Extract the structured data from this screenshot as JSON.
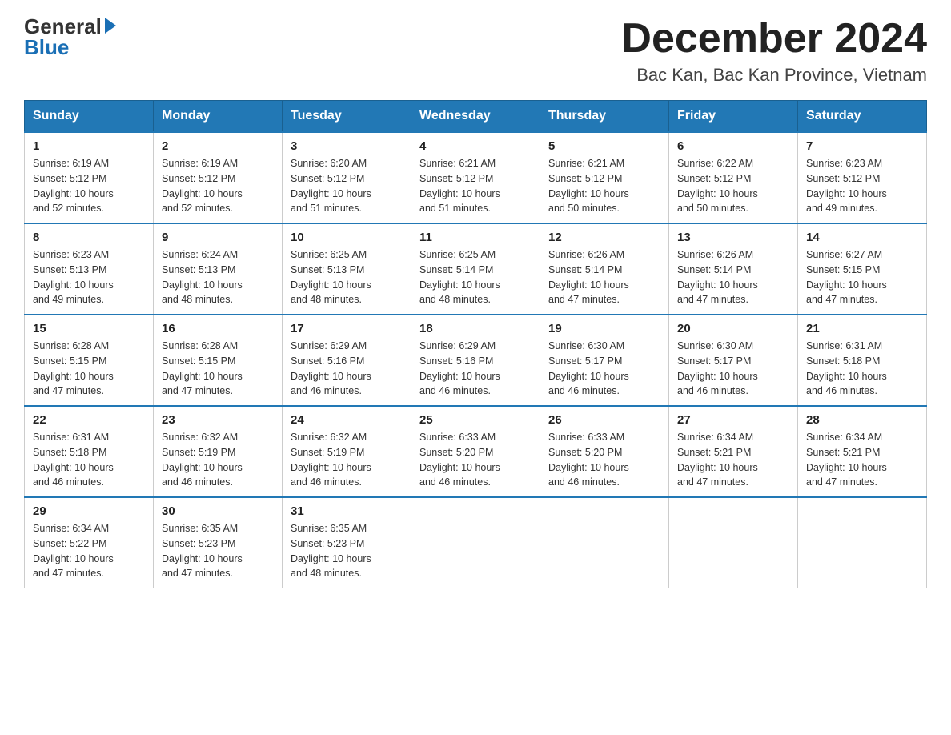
{
  "header": {
    "logo_general": "General",
    "logo_blue": "Blue",
    "title": "December 2024",
    "subtitle": "Bac Kan, Bac Kan Province, Vietnam"
  },
  "days_of_week": [
    "Sunday",
    "Monday",
    "Tuesday",
    "Wednesday",
    "Thursday",
    "Friday",
    "Saturday"
  ],
  "weeks": [
    [
      {
        "day": "1",
        "sunrise": "6:19 AM",
        "sunset": "5:12 PM",
        "daylight": "10 hours and 52 minutes."
      },
      {
        "day": "2",
        "sunrise": "6:19 AM",
        "sunset": "5:12 PM",
        "daylight": "10 hours and 52 minutes."
      },
      {
        "day": "3",
        "sunrise": "6:20 AM",
        "sunset": "5:12 PM",
        "daylight": "10 hours and 51 minutes."
      },
      {
        "day": "4",
        "sunrise": "6:21 AM",
        "sunset": "5:12 PM",
        "daylight": "10 hours and 51 minutes."
      },
      {
        "day": "5",
        "sunrise": "6:21 AM",
        "sunset": "5:12 PM",
        "daylight": "10 hours and 50 minutes."
      },
      {
        "day": "6",
        "sunrise": "6:22 AM",
        "sunset": "5:12 PM",
        "daylight": "10 hours and 50 minutes."
      },
      {
        "day": "7",
        "sunrise": "6:23 AM",
        "sunset": "5:12 PM",
        "daylight": "10 hours and 49 minutes."
      }
    ],
    [
      {
        "day": "8",
        "sunrise": "6:23 AM",
        "sunset": "5:13 PM",
        "daylight": "10 hours and 49 minutes."
      },
      {
        "day": "9",
        "sunrise": "6:24 AM",
        "sunset": "5:13 PM",
        "daylight": "10 hours and 48 minutes."
      },
      {
        "day": "10",
        "sunrise": "6:25 AM",
        "sunset": "5:13 PM",
        "daylight": "10 hours and 48 minutes."
      },
      {
        "day": "11",
        "sunrise": "6:25 AM",
        "sunset": "5:14 PM",
        "daylight": "10 hours and 48 minutes."
      },
      {
        "day": "12",
        "sunrise": "6:26 AM",
        "sunset": "5:14 PM",
        "daylight": "10 hours and 47 minutes."
      },
      {
        "day": "13",
        "sunrise": "6:26 AM",
        "sunset": "5:14 PM",
        "daylight": "10 hours and 47 minutes."
      },
      {
        "day": "14",
        "sunrise": "6:27 AM",
        "sunset": "5:15 PM",
        "daylight": "10 hours and 47 minutes."
      }
    ],
    [
      {
        "day": "15",
        "sunrise": "6:28 AM",
        "sunset": "5:15 PM",
        "daylight": "10 hours and 47 minutes."
      },
      {
        "day": "16",
        "sunrise": "6:28 AM",
        "sunset": "5:15 PM",
        "daylight": "10 hours and 47 minutes."
      },
      {
        "day": "17",
        "sunrise": "6:29 AM",
        "sunset": "5:16 PM",
        "daylight": "10 hours and 46 minutes."
      },
      {
        "day": "18",
        "sunrise": "6:29 AM",
        "sunset": "5:16 PM",
        "daylight": "10 hours and 46 minutes."
      },
      {
        "day": "19",
        "sunrise": "6:30 AM",
        "sunset": "5:17 PM",
        "daylight": "10 hours and 46 minutes."
      },
      {
        "day": "20",
        "sunrise": "6:30 AM",
        "sunset": "5:17 PM",
        "daylight": "10 hours and 46 minutes."
      },
      {
        "day": "21",
        "sunrise": "6:31 AM",
        "sunset": "5:18 PM",
        "daylight": "10 hours and 46 minutes."
      }
    ],
    [
      {
        "day": "22",
        "sunrise": "6:31 AM",
        "sunset": "5:18 PM",
        "daylight": "10 hours and 46 minutes."
      },
      {
        "day": "23",
        "sunrise": "6:32 AM",
        "sunset": "5:19 PM",
        "daylight": "10 hours and 46 minutes."
      },
      {
        "day": "24",
        "sunrise": "6:32 AM",
        "sunset": "5:19 PM",
        "daylight": "10 hours and 46 minutes."
      },
      {
        "day": "25",
        "sunrise": "6:33 AM",
        "sunset": "5:20 PM",
        "daylight": "10 hours and 46 minutes."
      },
      {
        "day": "26",
        "sunrise": "6:33 AM",
        "sunset": "5:20 PM",
        "daylight": "10 hours and 46 minutes."
      },
      {
        "day": "27",
        "sunrise": "6:34 AM",
        "sunset": "5:21 PM",
        "daylight": "10 hours and 47 minutes."
      },
      {
        "day": "28",
        "sunrise": "6:34 AM",
        "sunset": "5:21 PM",
        "daylight": "10 hours and 47 minutes."
      }
    ],
    [
      {
        "day": "29",
        "sunrise": "6:34 AM",
        "sunset": "5:22 PM",
        "daylight": "10 hours and 47 minutes."
      },
      {
        "day": "30",
        "sunrise": "6:35 AM",
        "sunset": "5:23 PM",
        "daylight": "10 hours and 47 minutes."
      },
      {
        "day": "31",
        "sunrise": "6:35 AM",
        "sunset": "5:23 PM",
        "daylight": "10 hours and 48 minutes."
      },
      null,
      null,
      null,
      null
    ]
  ],
  "labels": {
    "sunrise": "Sunrise:",
    "sunset": "Sunset:",
    "daylight": "Daylight:"
  }
}
